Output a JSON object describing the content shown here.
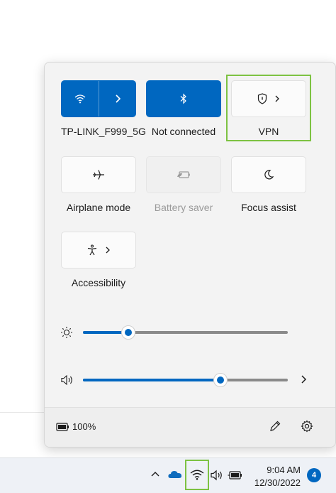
{
  "quick_settings": {
    "tiles": [
      {
        "id": "wifi",
        "label": "TP-LINK_F999_5G",
        "state": "on",
        "icon": "wifi-icon"
      },
      {
        "id": "bluetooth",
        "label": "Not connected",
        "state": "on",
        "icon": "bluetooth-icon"
      },
      {
        "id": "vpn",
        "label": "VPN",
        "state": "off",
        "icon": "shield-icon"
      },
      {
        "id": "airplane",
        "label": "Airplane mode",
        "state": "off",
        "icon": "airplane-icon"
      },
      {
        "id": "battery_saver",
        "label": "Battery saver",
        "state": "disabled",
        "icon": "battery-saver-icon"
      },
      {
        "id": "focus_assist",
        "label": "Focus assist",
        "state": "off",
        "icon": "moon-icon"
      },
      {
        "id": "accessibility",
        "label": "Accessibility",
        "state": "off",
        "icon": "accessibility-icon"
      }
    ],
    "brightness": {
      "value_fraction": 0.22,
      "icon": "sun-icon"
    },
    "volume": {
      "value_fraction": 0.67,
      "icon": "speaker-icon"
    },
    "footer": {
      "battery_text": "100%"
    }
  },
  "taskbar": {
    "time": "9:04 AM",
    "date": "12/30/2022",
    "notification_count": "4"
  },
  "colors": {
    "accent": "#0067c0",
    "highlight": "#7dc242"
  }
}
